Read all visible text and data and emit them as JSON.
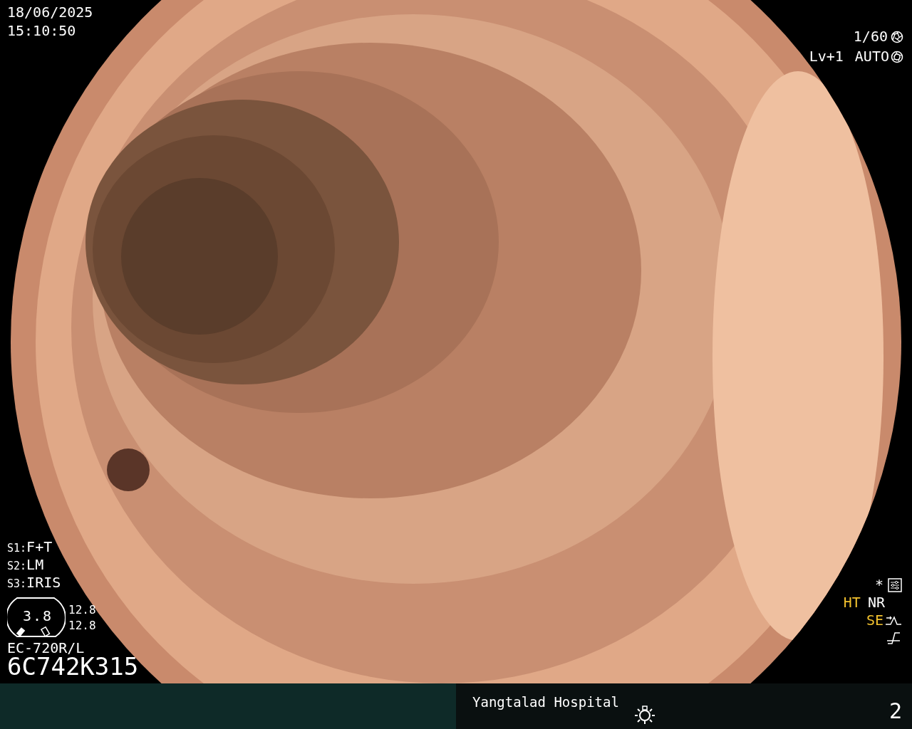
{
  "datetime": {
    "date": "18/06/2025",
    "time": "15:10:50"
  },
  "camera": {
    "shutter": "1/60",
    "level": "Lv+1",
    "iris": "AUTO"
  },
  "scope_settings": [
    {
      "label": "S1:",
      "value": "F+T"
    },
    {
      "label": "S2:",
      "value": "LM"
    },
    {
      "label": "S3:",
      "value": "IRIS"
    }
  ],
  "gauge": {
    "center": "3.8",
    "readings": [
      "12.8",
      "12.8"
    ]
  },
  "scope": {
    "model": "EC-720R/L",
    "serial": "6C742K315"
  },
  "modes": {
    "asterisk": "*",
    "items": [
      {
        "label": "HT",
        "highlighted": true
      },
      {
        "label": "NR",
        "highlighted": false
      }
    ],
    "enhancement": {
      "label": "SE",
      "highlighted": true
    }
  },
  "footer": {
    "hospital": "Yangtalad Hospital",
    "page": "2"
  }
}
